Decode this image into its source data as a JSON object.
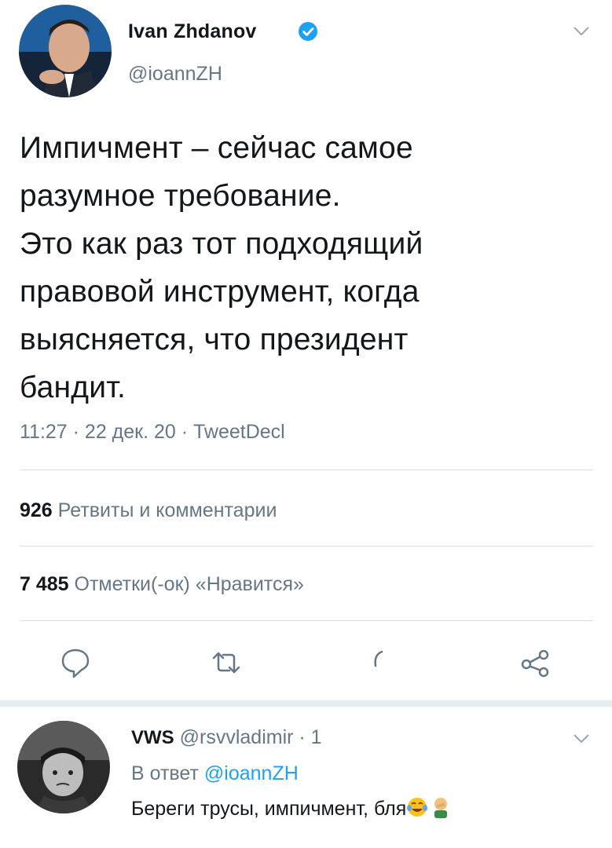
{
  "tweet": {
    "author_name": "Ivan Zhdanov",
    "author_handle": "@ioannZH",
    "text_lines": [
      "Импичмент – сейчас самое",
      "разумное требование.",
      "Это как раз тот подходящий",
      "правовой инструмент, когда",
      "выясняется, что президент",
      "бандит."
    ],
    "meta": "11:27 · 22 дек. 20 · TweetDecl",
    "retweets_count": "926",
    "retweets_label": "Ретвиты и комментарии",
    "likes_count": "7 485",
    "likes_label": "Отметки(-ок) «Нравится»"
  },
  "reply": {
    "author_name": "VWS",
    "author_handle_time": "@rsvvladimir · 1",
    "in_reply_prefix": "В ответ",
    "in_reply_handle": "@ioannZH",
    "text": "Береги трусы, импичмент, бля"
  },
  "colors": {
    "accent": "#1da1f2",
    "muted": "#657786",
    "divider": "#d8dde3"
  }
}
